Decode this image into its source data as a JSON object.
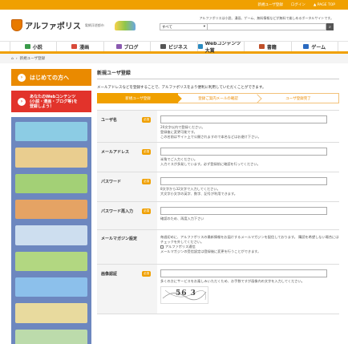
{
  "topbar": {
    "register": "新規ユーザ登録",
    "login": "ログイン",
    "pagetop": "▲ PAGE TOP"
  },
  "header": {
    "logo_text": "アルファポリス",
    "logo_sub": "電網浮遊都市",
    "tagline": "アルファポリスは小説、漫画、ゲーム、無料情報などが無料で楽しめるポータルサイトです。",
    "search_select": "すべて",
    "search_placeholder": ""
  },
  "nav": [
    {
      "label": "小説",
      "icon": "book-icon",
      "color": "#3a9a4a"
    },
    {
      "label": "漫画",
      "icon": "comic-icon",
      "color": "#d84a3a"
    },
    {
      "label": "ブログ",
      "icon": "blog-icon",
      "color": "#8a5ab0"
    },
    {
      "label": "ビジネス",
      "icon": "business-icon",
      "color": "#555555"
    },
    {
      "label": "Webコンテンツ大賞",
      "icon": "award-icon",
      "color": "#2a8ac0"
    },
    {
      "label": "書籍",
      "icon": "books-icon",
      "color": "#c0502a"
    },
    {
      "label": "ゲーム",
      "icon": "game-icon",
      "color": "#2a6ac0"
    }
  ],
  "breadcrumb": {
    "home_icon": "home-icon",
    "current": "新規ユーザ登録"
  },
  "sidebar": {
    "first_time": "はじめての方へ",
    "web_content_line1": "あなたのWebコンテンツ",
    "web_content_line2": "(小説・漫画・ブログ等)を",
    "web_content_line3": "登録しよう！",
    "banner_colors": [
      "#8fd4e8",
      "#f6d58a",
      "#a8d86e",
      "#f2a65a",
      "#d7e8f4",
      "#b9e07a",
      "#8fc6ef",
      "#f5e39a",
      "#c4e4a8"
    ]
  },
  "main": {
    "title": "新規ユーザ登録",
    "description": "メールアドレスなどを登録することで、アルファポリスをより便利に利用していただくことができます。",
    "steps": [
      "新規ユーザ登録",
      "登録ご案内メールの確認",
      "ユーザ登録完了"
    ],
    "required_label": "必須",
    "fields": {
      "username": {
        "label": "ユーザ名",
        "help1": "20文字以内で登録ください。",
        "help2": "登録後に変更可能です。",
        "help3": "この名前はサイト上で公開されますので本名などはお避け下さい。"
      },
      "email": {
        "label": "メールアドレス",
        "help1": "半角でご入力ください。",
        "help2": "入力ミスが多発しています。必ず登録前に確認を行ってください。"
      },
      "password": {
        "label": "パスワード",
        "help1": "8文字から32文字で入力してください。",
        "help2": "大文字小文字の英字、数字、記号が利用できます。"
      },
      "password_confirm": {
        "label": "パスワード再入力",
        "help1": "確認のため、再度入力下さい"
      },
      "mailmag": {
        "label": "メールマガジン設定",
        "help1": "毎週初めに、アルファポリスの最新情報をお届けするメールマガジンを配信しております。 購読を希望しない場合にはチェックを外してください。",
        "checkbox_label": "アルファポリス通信",
        "help2": "メールマガジンの受信設定は登録後に変更を行うことができます。"
      },
      "captcha": {
        "label": "画像認証",
        "help1": "多くの方にサービスをお楽しみいただくため、お手数ですが画像内の文字を入力してください。",
        "image_text": "56 3"
      }
    }
  }
}
